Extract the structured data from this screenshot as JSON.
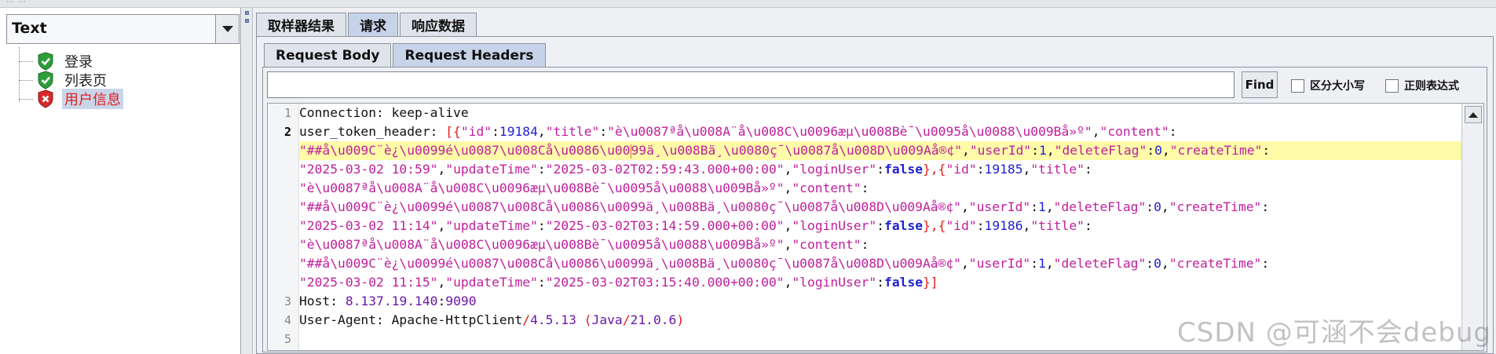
{
  "left_panel": {
    "combo_value": "Text",
    "tree": [
      {
        "label": "登录",
        "status": "success"
      },
      {
        "label": "列表页",
        "status": "success"
      },
      {
        "label": "用户信息",
        "status": "failed"
      }
    ]
  },
  "tabs": [
    "取样器结果",
    "请求",
    "响应数据"
  ],
  "active_tab": "请求",
  "subtabs": [
    "Request Body",
    "Request Headers"
  ],
  "active_subtab": "Request Headers",
  "search": {
    "value": "",
    "find_label": "Find",
    "case_label": "区分大小写",
    "regex_label": "正则表达式"
  },
  "editor": {
    "line_numbers": [
      "1",
      "2",
      "3",
      "4",
      "5"
    ],
    "current_line": "2",
    "lines": [
      {
        "segments": [
          {
            "t": "Connection: keep-alive",
            "c": "plain"
          }
        ]
      },
      {
        "segments": [
          {
            "t": "user_token_header: ",
            "c": "plain"
          },
          {
            "t": "[{",
            "c": "br"
          },
          {
            "t": "\"id\"",
            "c": "str"
          },
          {
            "t": ":",
            "c": "plain"
          },
          {
            "t": "19184",
            "c": "num"
          },
          {
            "t": ",",
            "c": "plain"
          },
          {
            "t": "\"title\"",
            "c": "str"
          },
          {
            "t": ":",
            "c": "plain"
          },
          {
            "t": "\"è\\u0087ªå\\u008A¨å\\u008C\\u0096æµ\\u008Bè¯\\u0095å\\u0088\\u009Bå»º\"",
            "c": "str"
          },
          {
            "t": ",",
            "c": "plain"
          },
          {
            "t": "\"content\"",
            "c": "str"
          },
          {
            "t": ":",
            "c": "plain"
          }
        ]
      },
      {
        "cur": true,
        "segments": [
          {
            "t": "\"##å\\u009C¨è¿\\u0099é\\u0087\\u008Cå\\u0086\\u00",
            "c": "str"
          },
          {
            "t": "|",
            "c": "caret"
          },
          {
            "t": "99ä¸\\u008Bä¸\\u0080ç¯\\u0087å\\u008D\\u009Aå®¢\"",
            "c": "str"
          },
          {
            "t": ",",
            "c": "plain"
          },
          {
            "t": "\"userId\"",
            "c": "str"
          },
          {
            "t": ":",
            "c": "plain"
          },
          {
            "t": "1",
            "c": "num"
          },
          {
            "t": ",",
            "c": "plain"
          },
          {
            "t": "\"deleteFlag\"",
            "c": "str"
          },
          {
            "t": ":",
            "c": "plain"
          },
          {
            "t": "0",
            "c": "num"
          },
          {
            "t": ",",
            "c": "plain"
          },
          {
            "t": "\"createTime\"",
            "c": "str"
          },
          {
            "t": ":",
            "c": "plain"
          }
        ]
      },
      {
        "segments": [
          {
            "t": "\"2025-03-02 10:59\"",
            "c": "str"
          },
          {
            "t": ",",
            "c": "plain"
          },
          {
            "t": "\"updateTime\"",
            "c": "str"
          },
          {
            "t": ":",
            "c": "plain"
          },
          {
            "t": "\"2025-03-02T02:59:43.000+00:00\"",
            "c": "str"
          },
          {
            "t": ",",
            "c": "plain"
          },
          {
            "t": "\"loginUser\"",
            "c": "str"
          },
          {
            "t": ":",
            "c": "plain"
          },
          {
            "t": "false",
            "c": "kw"
          },
          {
            "t": "},{",
            "c": "br"
          },
          {
            "t": "\"id\"",
            "c": "str"
          },
          {
            "t": ":",
            "c": "plain"
          },
          {
            "t": "19185",
            "c": "num"
          },
          {
            "t": ",",
            "c": "plain"
          },
          {
            "t": "\"title\"",
            "c": "str"
          },
          {
            "t": ":",
            "c": "plain"
          }
        ]
      },
      {
        "segments": [
          {
            "t": "\"è\\u0087ªå\\u008A¨å\\u008C\\u0096æµ\\u008Bè¯\\u0095å\\u0088\\u009Bå»º\"",
            "c": "str"
          },
          {
            "t": ",",
            "c": "plain"
          },
          {
            "t": "\"content\"",
            "c": "str"
          },
          {
            "t": ":",
            "c": "plain"
          }
        ]
      },
      {
        "segments": [
          {
            "t": "\"##å\\u009C¨è¿\\u0099é\\u0087\\u008Cå\\u0086\\u0099ä¸\\u008Bä¸\\u0080ç¯\\u0087å\\u008D\\u009Aå®¢\"",
            "c": "str"
          },
          {
            "t": ",",
            "c": "plain"
          },
          {
            "t": "\"userId\"",
            "c": "str"
          },
          {
            "t": ":",
            "c": "plain"
          },
          {
            "t": "1",
            "c": "num"
          },
          {
            "t": ",",
            "c": "plain"
          },
          {
            "t": "\"deleteFlag\"",
            "c": "str"
          },
          {
            "t": ":",
            "c": "plain"
          },
          {
            "t": "0",
            "c": "num"
          },
          {
            "t": ",",
            "c": "plain"
          },
          {
            "t": "\"createTime\"",
            "c": "str"
          },
          {
            "t": ":",
            "c": "plain"
          }
        ]
      },
      {
        "segments": [
          {
            "t": "\"2025-03-02 11:14\"",
            "c": "str"
          },
          {
            "t": ",",
            "c": "plain"
          },
          {
            "t": "\"updateTime\"",
            "c": "str"
          },
          {
            "t": ":",
            "c": "plain"
          },
          {
            "t": "\"2025-03-02T03:14:59.000+00:00\"",
            "c": "str"
          },
          {
            "t": ",",
            "c": "plain"
          },
          {
            "t": "\"loginUser\"",
            "c": "str"
          },
          {
            "t": ":",
            "c": "plain"
          },
          {
            "t": "false",
            "c": "kw"
          },
          {
            "t": "},{",
            "c": "br"
          },
          {
            "t": "\"id\"",
            "c": "str"
          },
          {
            "t": ":",
            "c": "plain"
          },
          {
            "t": "19186",
            "c": "num"
          },
          {
            "t": ",",
            "c": "plain"
          },
          {
            "t": "\"title\"",
            "c": "str"
          },
          {
            "t": ":",
            "c": "plain"
          }
        ]
      },
      {
        "segments": [
          {
            "t": "\"è\\u0087ªå\\u008A¨å\\u008C\\u0096æµ\\u008Bè¯\\u0095å\\u0088\\u009Bå»º\"",
            "c": "str"
          },
          {
            "t": ",",
            "c": "plain"
          },
          {
            "t": "\"content\"",
            "c": "str"
          },
          {
            "t": ":",
            "c": "plain"
          }
        ]
      },
      {
        "segments": [
          {
            "t": "\"##å\\u009C¨è¿\\u0099é\\u0087\\u008Cå\\u0086\\u0099ä¸\\u008Bä¸\\u0080ç¯\\u0087å\\u008D\\u009Aå®¢\"",
            "c": "str"
          },
          {
            "t": ",",
            "c": "plain"
          },
          {
            "t": "\"userId\"",
            "c": "str"
          },
          {
            "t": ":",
            "c": "plain"
          },
          {
            "t": "1",
            "c": "num"
          },
          {
            "t": ",",
            "c": "plain"
          },
          {
            "t": "\"deleteFlag\"",
            "c": "str"
          },
          {
            "t": ":",
            "c": "plain"
          },
          {
            "t": "0",
            "c": "num"
          },
          {
            "t": ",",
            "c": "plain"
          },
          {
            "t": "\"createTime\"",
            "c": "str"
          },
          {
            "t": ":",
            "c": "plain"
          }
        ]
      },
      {
        "segments": [
          {
            "t": "\"2025-03-02 11:15\"",
            "c": "str"
          },
          {
            "t": ",",
            "c": "plain"
          },
          {
            "t": "\"updateTime\"",
            "c": "str"
          },
          {
            "t": ":",
            "c": "plain"
          },
          {
            "t": "\"2025-03-02T03:15:40.000+00:00\"",
            "c": "str"
          },
          {
            "t": ",",
            "c": "plain"
          },
          {
            "t": "\"loginUser\"",
            "c": "str"
          },
          {
            "t": ":",
            "c": "plain"
          },
          {
            "t": "false",
            "c": "kw"
          },
          {
            "t": "}]",
            "c": "br"
          }
        ]
      },
      {
        "segments": [
          {
            "t": "Host: ",
            "c": "plain"
          },
          {
            "t": "8.137.19.140",
            "c": "host"
          },
          {
            "t": ":",
            "c": "plain"
          },
          {
            "t": "9090",
            "c": "host"
          }
        ]
      },
      {
        "segments": [
          {
            "t": "User-Agent: Apache-HttpClient",
            "c": "plain"
          },
          {
            "t": "/",
            "c": "br"
          },
          {
            "t": "4.5.13 ",
            "c": "host"
          },
          {
            "t": "(",
            "c": "br"
          },
          {
            "t": "Java",
            "c": "host"
          },
          {
            "t": "/",
            "c": "br"
          },
          {
            "t": "21.0.6",
            "c": "host"
          },
          {
            "t": ")",
            "c": "br"
          }
        ]
      },
      {
        "segments": []
      }
    ]
  },
  "watermark": "CSDN @可涵不会debug",
  "colors": {
    "string": "#c01f9c",
    "bracket": "#e21b1b",
    "number": "#1f1fd3",
    "current_line": "#fffba8",
    "failed_label": "#e02020"
  }
}
